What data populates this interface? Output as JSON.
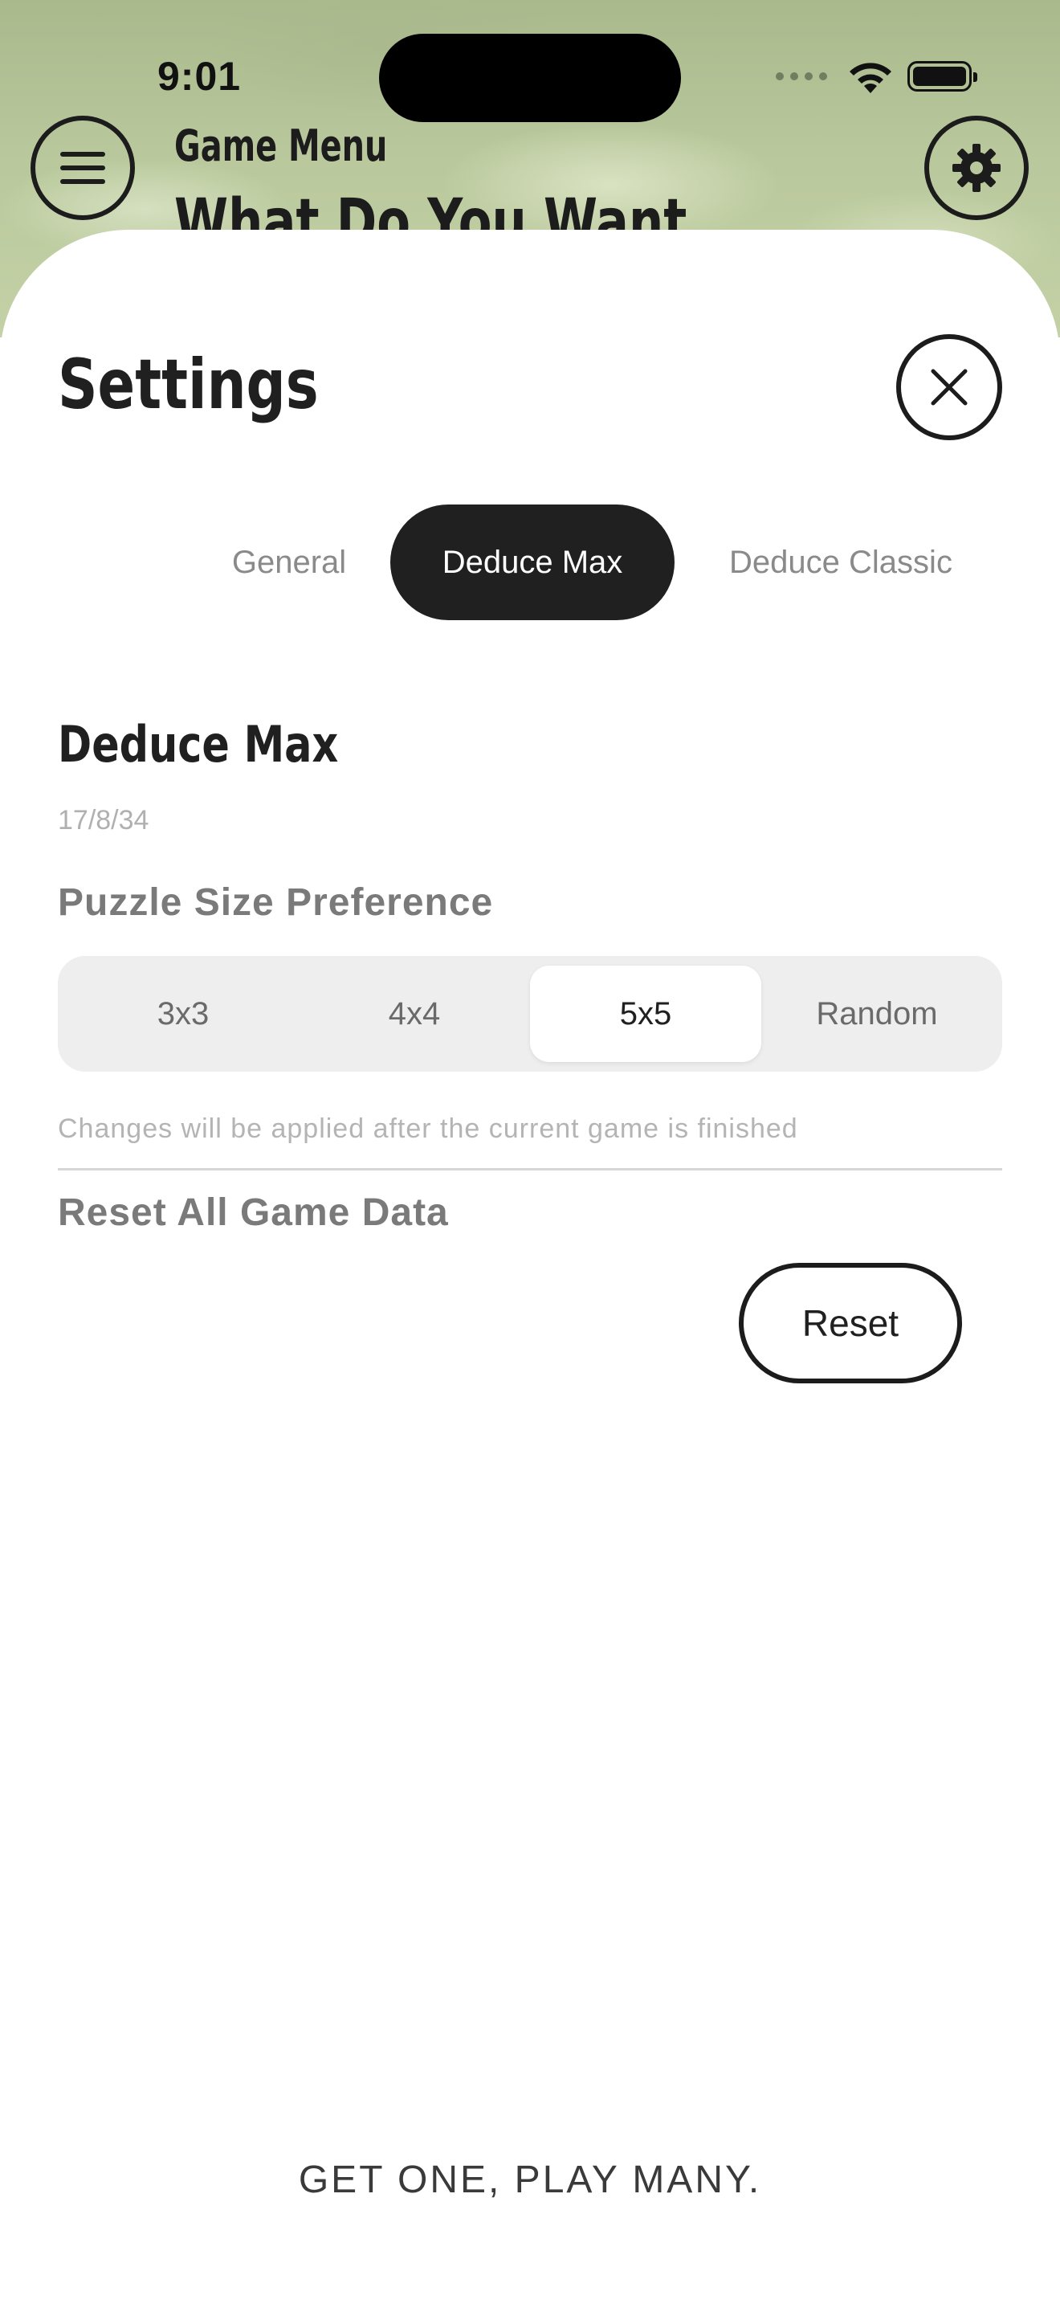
{
  "status_bar": {
    "time": "9:01"
  },
  "background": {
    "title": "Game Menu",
    "subtitle": "What Do You Want"
  },
  "sheet": {
    "title": "Settings",
    "tabs": [
      {
        "label": "General",
        "selected": false
      },
      {
        "label": "Deduce Max",
        "selected": true
      },
      {
        "label": "Deduce Classic",
        "selected": false
      }
    ],
    "section": {
      "title": "Deduce Max",
      "version": "17/8/34",
      "puzzle_size_label": "Puzzle Size Preference",
      "puzzle_size_options": [
        "3x3",
        "4x4",
        "5x5",
        "Random"
      ],
      "puzzle_size_selected": "5x5",
      "note": "Changes will be applied after the current game is finished",
      "reset_label": "Reset All Game Data",
      "reset_button": "Reset"
    },
    "tagline": "GET ONE, PLAY MANY."
  },
  "colors": {
    "accent_dark": "#202020",
    "background_green": "#b9c89c",
    "segment_bg": "#eeeeee"
  },
  "icons": [
    "hamburger-menu-icon",
    "gear-icon",
    "close-icon",
    "wifi-icon",
    "battery-icon"
  ]
}
